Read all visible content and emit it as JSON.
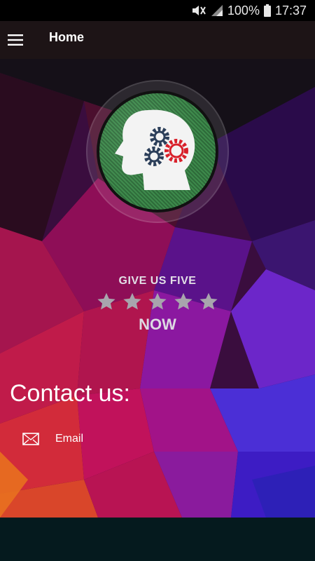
{
  "status_bar": {
    "battery": "100%",
    "time": "17:37",
    "icons": [
      "mute-icon",
      "signal-icon",
      "battery-icon"
    ]
  },
  "app_bar": {
    "title": "Home",
    "menu_icon": "hamburger-menu-icon"
  },
  "logo": {
    "icon": "head-gears-icon"
  },
  "rating": {
    "title": "GIVE US FIVE",
    "stars": 5,
    "cta": "NOW"
  },
  "contact": {
    "heading": "Contact us:",
    "email": {
      "label": "Email",
      "icon": "envelope-icon"
    }
  },
  "colors": {
    "status_bg": "#000000",
    "appbar_bg": "#1d1416",
    "footer_bg": "#051a1e",
    "star": "#a8a5ad",
    "logo_green": "#327641",
    "gear_navy": "#2c3f5a",
    "gear_red": "#d8202a"
  }
}
